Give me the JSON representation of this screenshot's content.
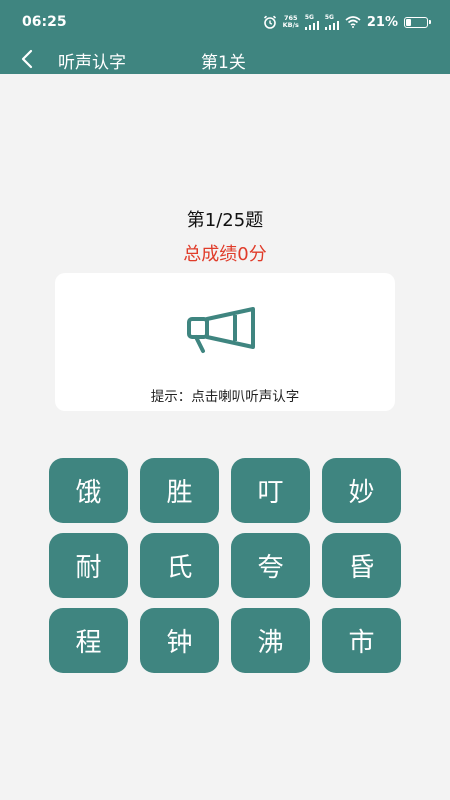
{
  "status_bar": {
    "time": "06:25",
    "net_speed_value": "765",
    "net_speed_unit": "KB/s",
    "signal1_label": "5G",
    "signal2_label": "5G",
    "battery_percent": "21%",
    "battery_level": 0.21
  },
  "app_bar": {
    "title": "听声认字",
    "level": "第1关"
  },
  "quiz": {
    "question_count": "第1/25题",
    "score": "总成绩0分",
    "hint": "提示：点击喇叭听声认字"
  },
  "choices": [
    "饿",
    "胜",
    "叮",
    "妙",
    "耐",
    "氏",
    "夸",
    "昏",
    "程",
    "钟",
    "沸",
    "市"
  ],
  "colors": {
    "primary": "#3f8580",
    "score_red": "#e03c2a",
    "background": "#f3f3f3"
  },
  "icons": {
    "back": "chevron-left-icon",
    "speaker": "megaphone-icon",
    "alarm": "alarm-clock-icon",
    "wifi": "wifi-icon",
    "battery": "battery-icon"
  }
}
